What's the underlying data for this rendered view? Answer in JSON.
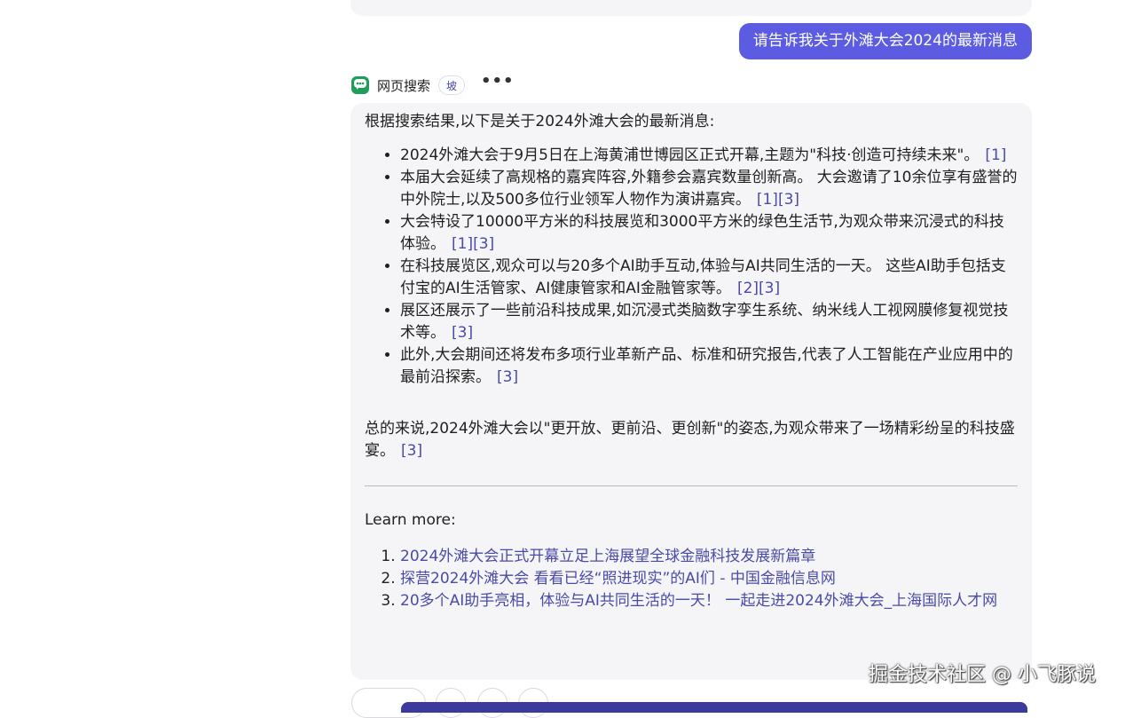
{
  "user_message": "请告诉我关于外滩大会2024的最新消息",
  "bot": {
    "name": "网页搜索",
    "badge": "坡",
    "more_label": "•••"
  },
  "answer": {
    "intro": "根据搜索结果,以下是关于2024外滩大会的最新消息:",
    "bullets": [
      {
        "text": "2024外滩大会于9月5日在上海黄浦世博园区正式开幕,主题为\"科技·创造可持续未来\"。",
        "cites": "[1]"
      },
      {
        "text": "本届大会延续了高规格的嘉宾阵容,外籍参会嘉宾数量创新高。 大会邀请了10余位享有盛誉的中外院士,以及500多位行业领军人物作为演讲嘉宾。",
        "cites": "[1][3]"
      },
      {
        "text": "大会特设了10000平方米的科技展览和3000平方米的绿色生活节,为观众带来沉浸式的科技体验。",
        "cites": "[1][3]"
      },
      {
        "text": "在科技展览区,观众可以与20多个AI助手互动,体验与AI共同生活的一天。 这些AI助手包括支付宝的AI生活管家、AI健康管家和AI金融管家等。",
        "cites": "[2][3]"
      },
      {
        "text": "展区还展示了一些前沿科技成果,如沉浸式类脑数字孪生系统、纳米线人工视网膜修复视觉技术等。",
        "cites": "[3]"
      },
      {
        "text": "此外,大会期间还将发布多项行业革新产品、标准和研究报告,代表了人工智能在产业应用中的最前沿探索。",
        "cites": "[3]"
      }
    ],
    "summary": "总的来说,2024外滩大会以\"更开放、更前沿、更创新\"的姿态,为观众带来了一场精彩纷呈的科技盛宴。",
    "summary_cite": "[3]",
    "learn_more_title": "Learn more:",
    "sources": [
      "2024外滩大会正式开幕立足上海展望全球金融科技发展新篇章",
      "探营2024外滩大会 看看已经“照进现实”的AI们 - 中国金融信息网",
      "20多个AI助手亮相，体验与AI共同生活的一天！ 一起走进2024外滩大会_上海国际人才网"
    ]
  },
  "watermark": "掘金技术社区 @ 小飞豚说",
  "colors": {
    "accent": "#5b5ce2",
    "link": "#4a4aa8",
    "card_bg": "#f5f5f7",
    "bot_avatar": "#1e9e5a"
  },
  "icons": {
    "bot_avatar": "chat-bubble-icon"
  }
}
